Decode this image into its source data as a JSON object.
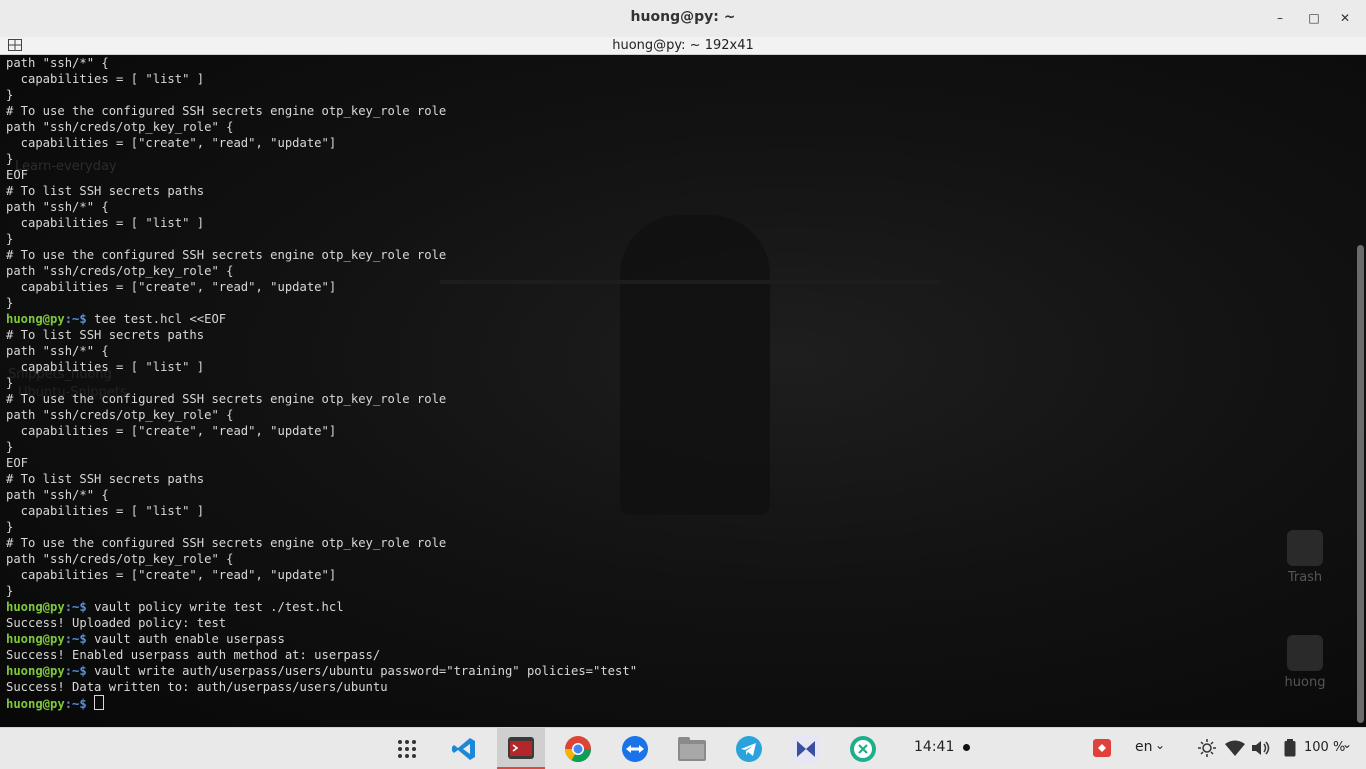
{
  "window": {
    "title": "huong@py: ~",
    "subtitle": "huong@py: ~ 192x41"
  },
  "terminal": {
    "lines": [
      {
        "t": "text",
        "v": "path \"ssh/*\" {"
      },
      {
        "t": "text",
        "v": "  capabilities = [ \"list\" ]"
      },
      {
        "t": "text",
        "v": "}"
      },
      {
        "t": "text",
        "v": "# To use the configured SSH secrets engine otp_key_role role"
      },
      {
        "t": "text",
        "v": "path \"ssh/creds/otp_key_role\" {"
      },
      {
        "t": "text",
        "v": "  capabilities = [\"create\", \"read\", \"update\"]"
      },
      {
        "t": "text",
        "v": "}"
      },
      {
        "t": "text",
        "v": "EOF"
      },
      {
        "t": "text",
        "v": "# To list SSH secrets paths"
      },
      {
        "t": "text",
        "v": "path \"ssh/*\" {"
      },
      {
        "t": "text",
        "v": "  capabilities = [ \"list\" ]"
      },
      {
        "t": "text",
        "v": "}"
      },
      {
        "t": "text",
        "v": "# To use the configured SSH secrets engine otp_key_role role"
      },
      {
        "t": "text",
        "v": "path \"ssh/creds/otp_key_role\" {"
      },
      {
        "t": "text",
        "v": "  capabilities = [\"create\", \"read\", \"update\"]"
      },
      {
        "t": "text",
        "v": "}"
      },
      {
        "t": "cmd",
        "v": "tee test.hcl <<EOF"
      },
      {
        "t": "text",
        "v": "# To list SSH secrets paths"
      },
      {
        "t": "text",
        "v": "path \"ssh/*\" {"
      },
      {
        "t": "text",
        "v": "  capabilities = [ \"list\" ]"
      },
      {
        "t": "text",
        "v": "}"
      },
      {
        "t": "text",
        "v": "# To use the configured SSH secrets engine otp_key_role role"
      },
      {
        "t": "text",
        "v": "path \"ssh/creds/otp_key_role\" {"
      },
      {
        "t": "text",
        "v": "  capabilities = [\"create\", \"read\", \"update\"]"
      },
      {
        "t": "text",
        "v": "}"
      },
      {
        "t": "text",
        "v": "EOF"
      },
      {
        "t": "text",
        "v": "# To list SSH secrets paths"
      },
      {
        "t": "text",
        "v": "path \"ssh/*\" {"
      },
      {
        "t": "text",
        "v": "  capabilities = [ \"list\" ]"
      },
      {
        "t": "text",
        "v": "}"
      },
      {
        "t": "text",
        "v": "# To use the configured SSH secrets engine otp_key_role role"
      },
      {
        "t": "text",
        "v": "path \"ssh/creds/otp_key_role\" {"
      },
      {
        "t": "text",
        "v": "  capabilities = [\"create\", \"read\", \"update\"]"
      },
      {
        "t": "text",
        "v": "}"
      },
      {
        "t": "cmd",
        "v": "vault policy write test ./test.hcl"
      },
      {
        "t": "text",
        "v": "Success! Uploaded policy: test"
      },
      {
        "t": "cmd",
        "v": "vault auth enable userpass"
      },
      {
        "t": "text",
        "v": "Success! Enabled userpass auth method at: userpass/"
      },
      {
        "t": "cmd",
        "v": "vault write auth/userpass/users/ubuntu password=\"training\" policies=\"test\""
      },
      {
        "t": "text",
        "v": "Success! Data written to: auth/userpass/users/ubuntu"
      },
      {
        "t": "cmd",
        "v": "",
        "cursor": true
      }
    ],
    "prompt_user": "huong@py",
    "prompt_path": ":~$ "
  },
  "desktop": {
    "trash_label": "Trash",
    "home_label": "huong",
    "faded_text_1": "Learn-everyday",
    "faded_text_2": "Snippets_huong",
    "faded_text_3": "Ubuntu-Snippets"
  },
  "taskbar": {
    "clock": "14:41",
    "language": "en",
    "battery": "100 %",
    "apps": [
      "app-grid-icon",
      "vscode-icon",
      "terminal-icon",
      "chrome-icon",
      "teamviewer-icon",
      "files-icon",
      "telegram-icon",
      "slack-icon",
      "gitkraken-icon"
    ]
  },
  "colors": {
    "prompt_user": "#7ec93a",
    "prompt_path": "#5c8fd6",
    "text": "#d8d8d8",
    "accent": "#d94c3d"
  }
}
